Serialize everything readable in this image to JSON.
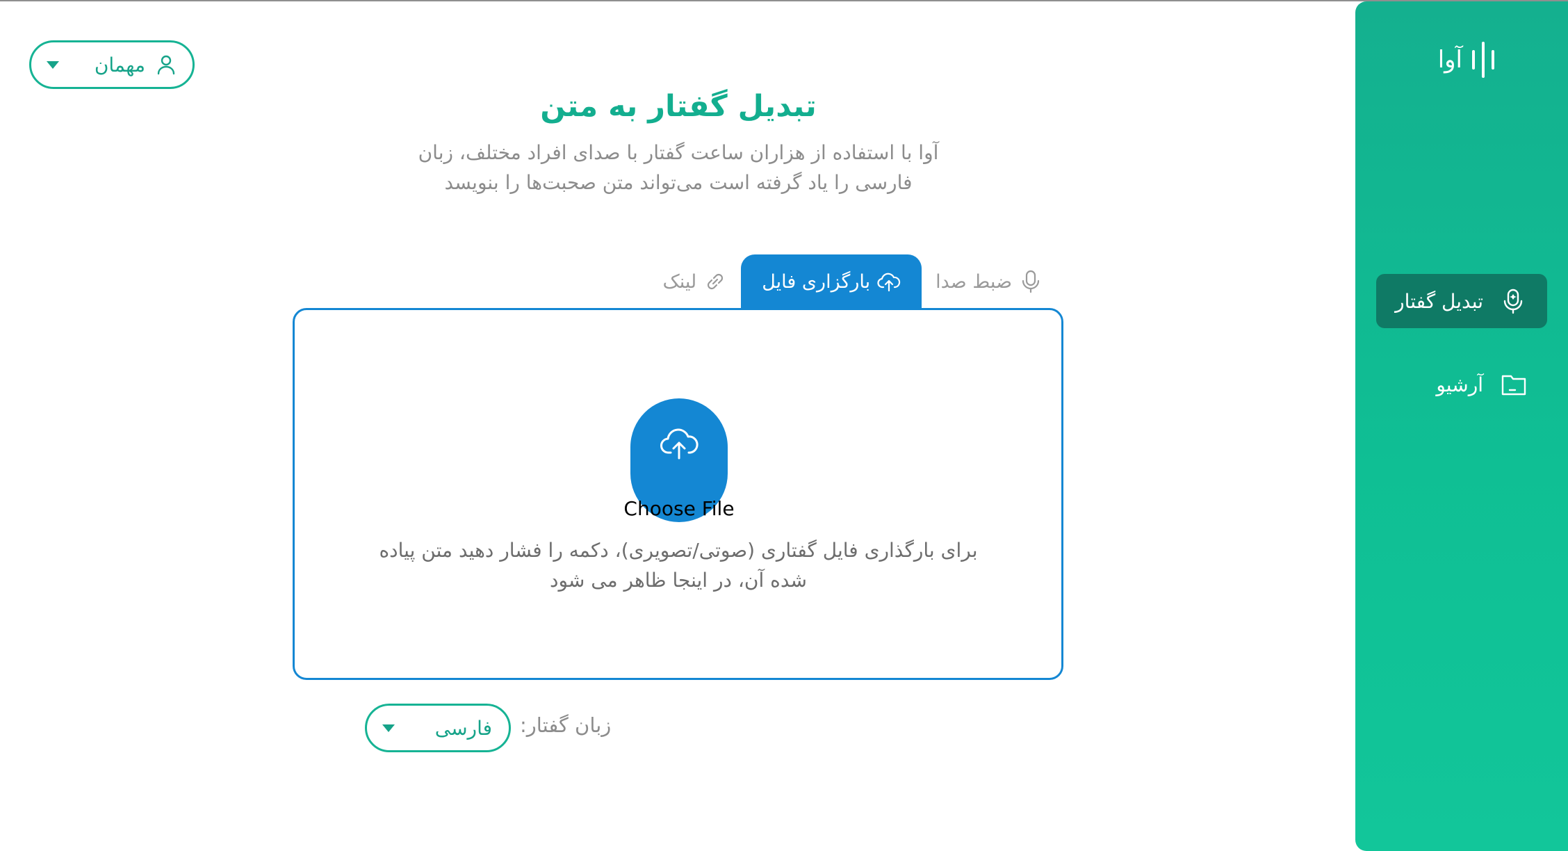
{
  "app": {
    "logo_text": "آوا"
  },
  "user_menu": {
    "label": "مهمان"
  },
  "sidebar": {
    "items": [
      {
        "label": "تبدیل گفتار",
        "icon": "microphone-sparkle-icon",
        "active": true
      },
      {
        "label": "آرشیو",
        "icon": "folder-icon",
        "active": false
      }
    ]
  },
  "header": {
    "title": "تبدیل گفتار به متن",
    "subtitle": "آوا با استفاده از هزاران ساعت گفتار با صدای افراد مختلف، زبان فارسی را یاد گرفته است می‌تواند متن صحبت‌ها را بنویسد"
  },
  "tabs": [
    {
      "label": "ضبط صدا",
      "icon": "microphone-icon",
      "active": false
    },
    {
      "label": "بارگزاری فایل",
      "icon": "cloud-upload-icon",
      "active": true
    },
    {
      "label": "لینک",
      "icon": "link-icon",
      "active": false
    }
  ],
  "upload": {
    "button_label": "Choose File",
    "hint": "برای بارگذاری فایل گفتاری (صوتی/تصویری)، دکمه را فشار دهید متن پیاده شده آن، در اینجا ظاهر می شود"
  },
  "language": {
    "label": "زبان گفتار:",
    "value": "فارسی"
  },
  "colors": {
    "brand_green": "#13ae8f",
    "accent_blue": "#1487d3",
    "active_nav": "#0f7a65"
  }
}
